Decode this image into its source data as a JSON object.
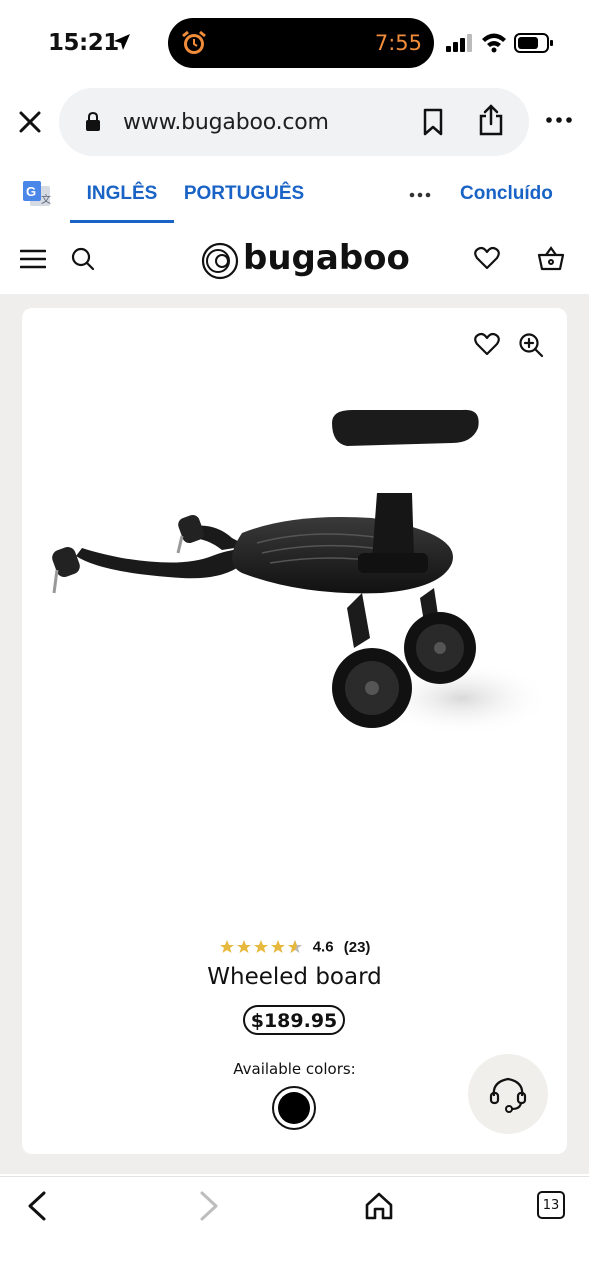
{
  "status_bar": {
    "time": "15:21",
    "island_time": "7:55",
    "island_time_color": "#f08c3a"
  },
  "browser": {
    "url": "www.bugaboo.com",
    "icons": [
      "close-icon",
      "lock-icon",
      "bookmark-icon",
      "share-icon",
      "more-icon"
    ]
  },
  "translate": {
    "tabs": [
      {
        "label": "INGLÊS",
        "active": true
      },
      {
        "label": "PORTUGUÊS",
        "active": false
      }
    ],
    "done_label": "Concluído",
    "accent": "#1a63c6"
  },
  "site_header": {
    "logo_text": "bugaboo",
    "icons": [
      "menu-icon",
      "search-icon",
      "heart-icon",
      "basket-icon"
    ]
  },
  "product": {
    "rating": "4.6",
    "rating_count": "(23)",
    "stars_filled": 4.6,
    "name": "Wheeled board",
    "price": "$189.95",
    "colors_label": "Available colors:",
    "selected_color": "#000000"
  },
  "bottom_bar": {
    "tabs_count": "13"
  }
}
